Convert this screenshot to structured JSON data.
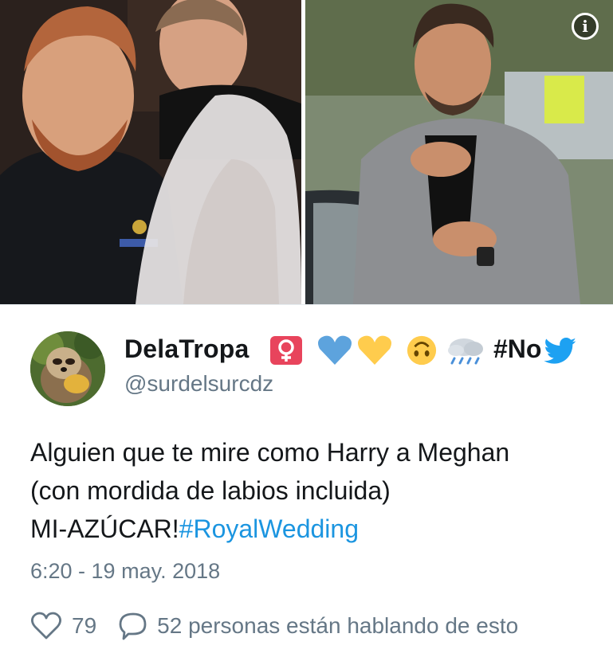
{
  "media": {
    "left_photo": "wedding-photo",
    "right_photo": "man-with-hand-on-chest-photo",
    "info_icon": "info-icon"
  },
  "tweet": {
    "author": {
      "display_name": "DelaTropa",
      "handle": "@surdelsurcdz",
      "name_emojis": [
        "female-sign",
        "blue-heart",
        "yellow-heart",
        "upside-down-face",
        "cloud-with-rain"
      ],
      "name_hashtag_truncated": "#No"
    },
    "text": {
      "line1": "Alguien que te mire como Harry a Meghan",
      "line2": "(con mordida de labios incluida)",
      "line3_prefix": "MI-AZÚCAR!",
      "hashtag": "#RoyalWedding"
    },
    "timestamp": "6:20 - 19 may. 2018",
    "likes": "79",
    "conversation": "52 personas están hablando de esto"
  },
  "colors": {
    "link": "#1b95e0",
    "secondary_text": "#657786",
    "primary_text": "#14171a",
    "twitter_blue": "#1da1f2"
  }
}
